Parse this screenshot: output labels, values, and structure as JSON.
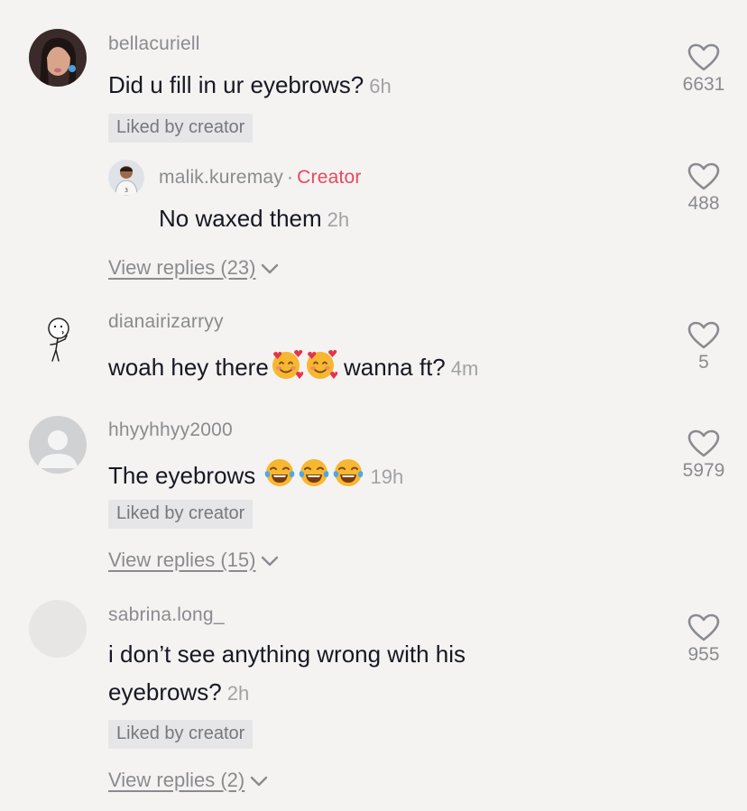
{
  "comments": [
    {
      "username": "bellacuriell",
      "text": "Did u fill in ur eyebrows?",
      "time": "6h",
      "badge": "Liked by creator",
      "likes": "6631",
      "reply": {
        "username": "malik.kuremay",
        "creator_label": "Creator",
        "separator": "·",
        "text": "No waxed them",
        "time": "2h",
        "likes": "488"
      },
      "view_replies": "View replies (23)"
    },
    {
      "username": "dianairizarryy",
      "text_before": "woah hey there",
      "emojis": [
        "smiling-face-with-hearts",
        "smiling-face-with-hearts"
      ],
      "text_after": " wanna ft?",
      "time": "4m",
      "likes": "5"
    },
    {
      "username": "hhyyhhyy2000",
      "text": "The eyebrows ",
      "emojis": [
        "face-with-tears-of-joy",
        "face-with-tears-of-joy",
        "face-with-tears-of-joy"
      ],
      "time": "19h",
      "badge": "Liked by creator",
      "likes": "5979",
      "view_replies": "View replies (15)"
    },
    {
      "username": "sabrina.long_",
      "text": "i don’t see anything wrong with his eyebrows?",
      "time": "2h",
      "badge": "Liked by creator",
      "likes": "955",
      "view_replies": "View replies (2)"
    }
  ],
  "colors": {
    "background": "#f4f3f1",
    "username": "#8a8b91",
    "text": "#161823",
    "creator": "#e84860",
    "badge_bg": "#e6e6e8"
  }
}
